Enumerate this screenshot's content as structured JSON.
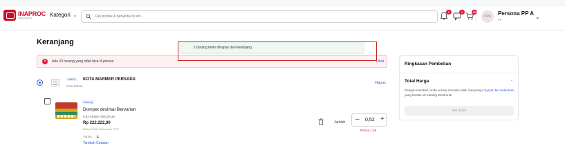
{
  "brand": {
    "name": "INAPROC",
    "tagline": "Katalog Elektronik"
  },
  "header": {
    "kategori_label": "Kategori",
    "search_placeholder": "Cari produk & penyedia di sini...",
    "badges": {
      "notifications": "2",
      "messages": "1",
      "cart": "65"
    },
    "user": {
      "initials": "PPA",
      "name": "Persona PP A",
      "role": "PP"
    }
  },
  "page": {
    "title": "Keranjang"
  },
  "toast": {
    "message": "1 barang telah dihapus dari keranjang."
  },
  "alert": {
    "message": "Ada 33 barang yang tidak bisa di proses.",
    "link": "Lihat"
  },
  "store": {
    "badge": "UMKK",
    "name": "KOTA MARMER PERSADA",
    "location": "Kota Batam",
    "delete_label": "Hapus"
  },
  "item": {
    "badge": "Barang",
    "name": "Dompet desimal Bervarian",
    "qty_info": "0,52 Ampul (104,00 gr)",
    "price": "Rp 222.222,00",
    "tax_note": "Belum/Tidak Dikenakan PPN",
    "variant_label": "Varian:",
    "variant_value": "L",
    "note_link": "Tambah Catatan",
    "jumlah_label": "Jumlah",
    "quantity": "0,52",
    "remaining": "Tersisa 1.56"
  },
  "summary": {
    "title": "Ringkasan Pembelian",
    "total_label": "Total Harga",
    "total_value": "-",
    "terms_prefix": "Dengan membeli, Anda secara otomatis telah menyetujui",
    "terms_link": "Syarat dan Ketentuan",
    "terms_suffix": "yang berlaku di Katalog Elektronik.",
    "buy_button": "Beli (0,00)"
  },
  "colors": {
    "brand_red": "#c8102e",
    "link_blue": "#2e5bd8",
    "alert_red": "#e11d48"
  }
}
